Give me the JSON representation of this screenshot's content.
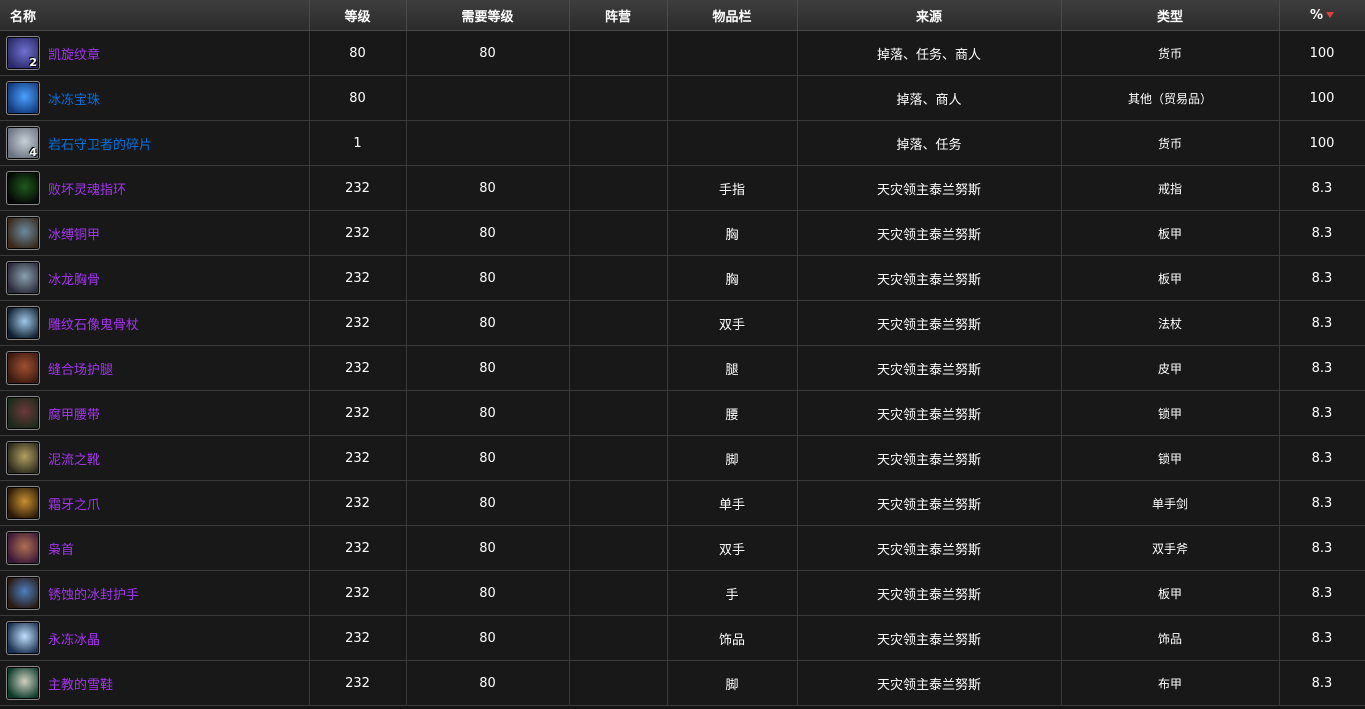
{
  "header": {
    "name": "名称",
    "level": "等级",
    "req_level": "需要等级",
    "side": "阵营",
    "slot": "物品栏",
    "source": "来源",
    "type": "类型",
    "pct": "%"
  },
  "rows": [
    {
      "name": "凯旋纹章",
      "quality": "epic",
      "icon": "emblem-icon",
      "icon_colors": [
        "#2a2a6a",
        "#7070d0"
      ],
      "count": "2",
      "level": "80",
      "req": "80",
      "side": "",
      "slot": "",
      "source": "掉落、任务、商人",
      "type": "货币",
      "pct": "100"
    },
    {
      "name": "冰冻宝珠",
      "quality": "rare",
      "icon": "frozen-orb-icon",
      "icon_colors": [
        "#123a7a",
        "#4aa0ff"
      ],
      "count": "",
      "level": "80",
      "req": "",
      "side": "",
      "slot": "",
      "source": "掉落、商人",
      "type": "其他（贸易品）",
      "pct": "100"
    },
    {
      "name": "岩石守卫者的碎片",
      "quality": "rare",
      "icon": "stone-shard-icon",
      "icon_colors": [
        "#6a7480",
        "#c8d0d8"
      ],
      "count": "4",
      "level": "1",
      "req": "",
      "side": "",
      "slot": "",
      "source": "掉落、任务",
      "type": "货币",
      "pct": "100"
    },
    {
      "name": "败坏灵魂指环",
      "quality": "epic",
      "icon": "ring-icon",
      "icon_colors": [
        "#050805",
        "#1e5a1e"
      ],
      "count": "",
      "level": "232",
      "req": "80",
      "side": "",
      "slot": "手指",
      "source": "天灾领主泰兰努斯",
      "type": "戒指",
      "pct": "8.3"
    },
    {
      "name": "冰缚铜甲",
      "quality": "epic",
      "icon": "chest-armor-icon",
      "icon_colors": [
        "#3a2818",
        "#6a8aa0"
      ],
      "count": "",
      "level": "232",
      "req": "80",
      "side": "",
      "slot": "胸",
      "source": "天灾领主泰兰努斯",
      "type": "板甲",
      "pct": "8.3"
    },
    {
      "name": "冰龙胸骨",
      "quality": "epic",
      "icon": "breastplate-icon",
      "icon_colors": [
        "#2a2a38",
        "#8aa0b0"
      ],
      "count": "",
      "level": "232",
      "req": "80",
      "side": "",
      "slot": "胸",
      "source": "天灾领主泰兰努斯",
      "type": "板甲",
      "pct": "8.3"
    },
    {
      "name": "雕纹石像鬼骨杖",
      "quality": "epic",
      "icon": "staff-icon",
      "icon_colors": [
        "#102030",
        "#a0c8e8"
      ],
      "count": "",
      "level": "232",
      "req": "80",
      "side": "",
      "slot": "双手",
      "source": "天灾领主泰兰努斯",
      "type": "法杖",
      "pct": "8.3"
    },
    {
      "name": "缝合场护腿",
      "quality": "epic",
      "icon": "leggings-icon",
      "icon_colors": [
        "#3a1a10",
        "#a05030"
      ],
      "count": "",
      "level": "232",
      "req": "80",
      "side": "",
      "slot": "腿",
      "source": "天灾领主泰兰努斯",
      "type": "皮甲",
      "pct": "8.3"
    },
    {
      "name": "腐甲腰带",
      "quality": "epic",
      "icon": "belt-icon",
      "icon_colors": [
        "#1a2a1a",
        "#6a3a3a"
      ],
      "count": "",
      "level": "232",
      "req": "80",
      "side": "",
      "slot": "腰",
      "source": "天灾领主泰兰努斯",
      "type": "锁甲",
      "pct": "8.3"
    },
    {
      "name": "泥流之靴",
      "quality": "epic",
      "icon": "boots-icon",
      "icon_colors": [
        "#2a2a1a",
        "#b0a060"
      ],
      "count": "",
      "level": "232",
      "req": "80",
      "side": "",
      "slot": "脚",
      "source": "天灾领主泰兰努斯",
      "type": "锁甲",
      "pct": "8.3"
    },
    {
      "name": "霜牙之爪",
      "quality": "epic",
      "icon": "sword-icon",
      "icon_colors": [
        "#2a1a08",
        "#c89030"
      ],
      "count": "",
      "level": "232",
      "req": "80",
      "side": "",
      "slot": "单手",
      "source": "天灾领主泰兰努斯",
      "type": "单手剑",
      "pct": "8.3"
    },
    {
      "name": "枭首",
      "quality": "epic",
      "icon": "axe-icon",
      "icon_colors": [
        "#3a1838",
        "#b07050"
      ],
      "count": "",
      "level": "232",
      "req": "80",
      "side": "",
      "slot": "双手",
      "source": "天灾领主泰兰努斯",
      "type": "双手斧",
      "pct": "8.3"
    },
    {
      "name": "锈蚀的冰封护手",
      "quality": "epic",
      "icon": "gauntlets-icon",
      "icon_colors": [
        "#2a1a10",
        "#4a80c0"
      ],
      "count": "",
      "level": "232",
      "req": "80",
      "side": "",
      "slot": "手",
      "source": "天灾领主泰兰努斯",
      "type": "板甲",
      "pct": "8.3"
    },
    {
      "name": "永冻冰晶",
      "quality": "epic",
      "icon": "ice-crystal-icon",
      "icon_colors": [
        "#1a3050",
        "#c0e0ff"
      ],
      "count": "",
      "level": "232",
      "req": "80",
      "side": "",
      "slot": "饰品",
      "source": "天灾领主泰兰努斯",
      "type": "饰品",
      "pct": "8.3"
    },
    {
      "name": "主教的雪鞋",
      "quality": "epic",
      "icon": "cloth-boots-icon",
      "icon_colors": [
        "#0a3a2a",
        "#d0d0c0"
      ],
      "count": "",
      "level": "232",
      "req": "80",
      "side": "",
      "slot": "脚",
      "source": "天灾领主泰兰努斯",
      "type": "布甲",
      "pct": "8.3"
    }
  ]
}
